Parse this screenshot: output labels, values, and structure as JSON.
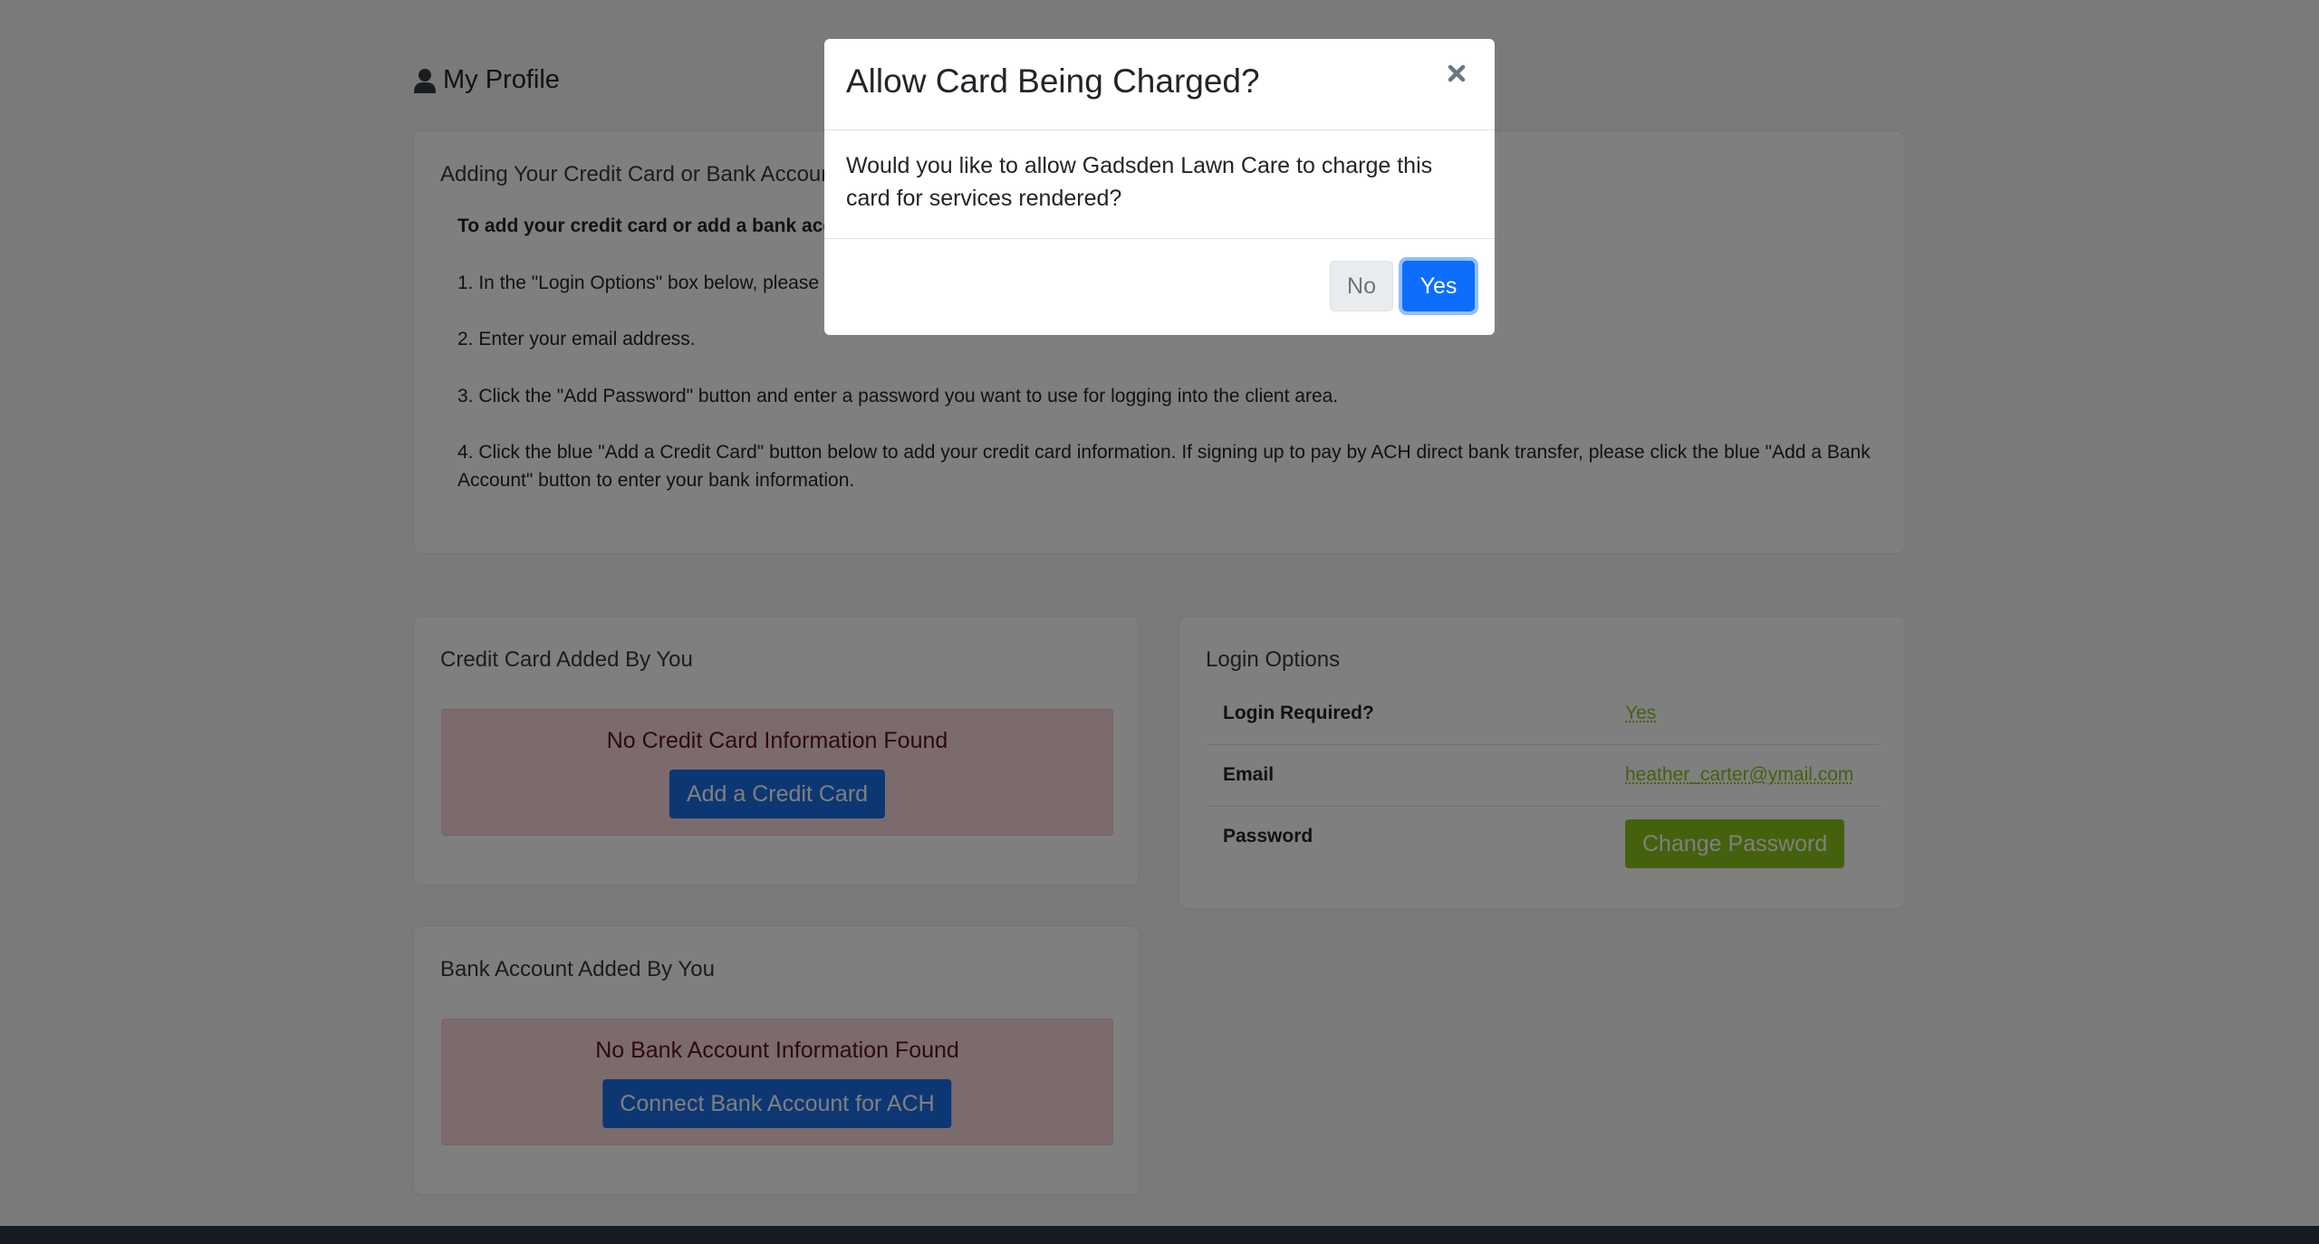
{
  "profile": {
    "heading": "My Profile",
    "icon": "user-icon"
  },
  "instructions": {
    "title": "Adding Your Credit Card or Bank Account",
    "bold_line": "To add your credit card or add a bank account:",
    "steps": [
      "1. In the \"Login Options\" box below, please",
      "2. Enter your email address.",
      "3. Click the \"Add Password\" button and enter a password you want to use for logging into the client area.",
      "4. Click the blue \"Add a Credit Card\" button below to add your credit card information. If signing up to pay by ACH direct bank transfer, please click the blue \"Add a Bank Account\" button to enter your bank information."
    ]
  },
  "credit_card": {
    "title": "Credit Card Added By You",
    "empty_text": "No Credit Card Information Found",
    "button_label": "Add a Credit Card"
  },
  "bank_account": {
    "title": "Bank Account Added By You",
    "empty_text": "No Bank Account Information Found",
    "button_label": "Connect Bank Account for ACH"
  },
  "login_options": {
    "title": "Login Options",
    "rows": [
      {
        "label": "Login Required?",
        "value": "Yes"
      },
      {
        "label": "Email",
        "value": "heather_carter@ymail.com"
      },
      {
        "label": "Password",
        "button_label": "Change Password"
      }
    ]
  },
  "modal": {
    "title": "Allow Card Being Charged?",
    "body": "Would you like to allow Gadsden Lawn Care to charge this card for services rendered?",
    "no_label": "No",
    "yes_label": "Yes",
    "close_icon": "close-icon"
  },
  "colors": {
    "primary": "#0d6efd",
    "accent_green": "#89c31d",
    "alert_bg": "#f8d7da",
    "alert_text": "#58151c"
  }
}
